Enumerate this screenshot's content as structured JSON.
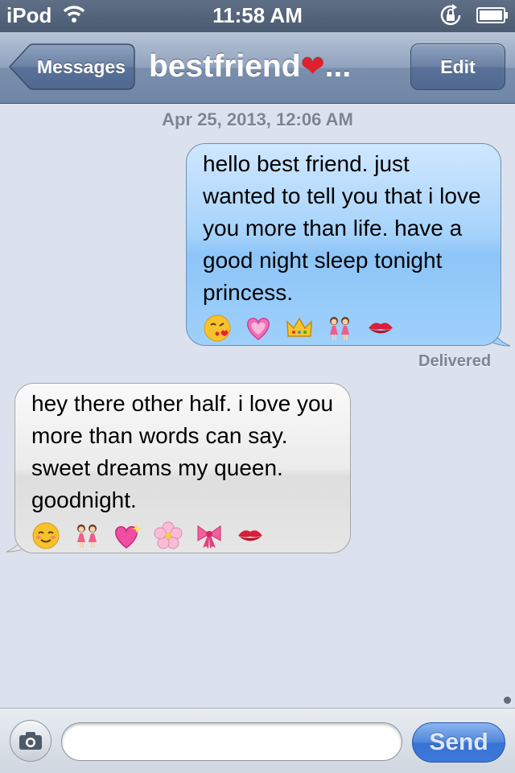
{
  "status_bar": {
    "carrier": "iPod",
    "time": "11:58 AM",
    "icons": [
      "wifi-icon",
      "rotation-lock-icon",
      "battery-icon"
    ]
  },
  "nav": {
    "back_label": "Messages",
    "title": "bestfriend",
    "title_emoji": "❤",
    "title_ellipsis": "...",
    "edit_label": "Edit"
  },
  "conversation": {
    "timestamp": "Apr 25, 2013, 12:06 AM",
    "messages": [
      {
        "direction": "outgoing",
        "text": "hello best friend. just wanted to tell you that i love you more than life. have a good night sleep tonight princess.",
        "emojis": [
          "kissing-face-icon",
          "growing-heart-icon",
          "crown-icon",
          "two-women-icon",
          "kiss-mark-icon"
        ],
        "status": "Delivered"
      },
      {
        "direction": "incoming",
        "text": "hey there other half. i love you more than words can say. sweet dreams my queen. goodnight.",
        "emojis": [
          "smiling-face-icon",
          "two-women-icon",
          "sparkling-heart-icon",
          "cherry-blossom-icon",
          "ribbon-icon",
          "kiss-mark-icon"
        ]
      }
    ]
  },
  "composer": {
    "placeholder": "",
    "value": "",
    "send_label": "Send"
  },
  "colors": {
    "outgoing_bubble": "#a6d3fb",
    "incoming_bubble": "#e6e6e6",
    "background": "#dbe2ed",
    "send_button": "#3d79d8"
  }
}
